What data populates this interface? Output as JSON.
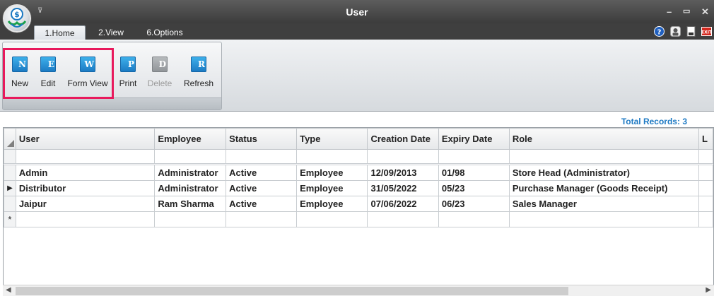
{
  "window": {
    "title": "User",
    "qat_glyph": "⊽",
    "controls": {
      "minimize": "–",
      "maximize": "▭",
      "close": "✕"
    }
  },
  "tabs": [
    {
      "label": "1.Home",
      "active": true
    },
    {
      "label": "2.View",
      "active": false
    },
    {
      "label": "6.Options",
      "active": false
    }
  ],
  "right_icons": [
    "help-icon",
    "user-icon",
    "document-icon",
    "exit-icon"
  ],
  "ribbon": {
    "buttons": [
      {
        "label": "New",
        "letter": "N",
        "enabled": true
      },
      {
        "label": "Edit",
        "letter": "E",
        "enabled": true
      },
      {
        "label": "Form View",
        "letter": "W",
        "enabled": true
      },
      {
        "label": "Print",
        "letter": "P",
        "enabled": true
      },
      {
        "label": "Delete",
        "letter": "D",
        "enabled": false
      },
      {
        "label": "Refresh",
        "letter": "R",
        "enabled": true
      }
    ],
    "highlight_color": "#e8195c"
  },
  "total_records": "Total Records: 3",
  "grid": {
    "columns": [
      "User",
      "Employee",
      "Status",
      "Type",
      "Creation Date",
      "Expiry Date",
      "Role",
      "L"
    ],
    "rows": [
      [
        "Admin",
        "Administrator",
        "Active",
        "Employee",
        "12/09/2013",
        "01/98",
        "Store Head (Administrator)",
        ""
      ],
      [
        "Distributor",
        "Administrator",
        "Active",
        "Employee",
        "31/05/2022",
        "05/23",
        "Purchase Manager (Goods Receipt)",
        ""
      ],
      [
        "Jaipur",
        "Ram Sharma",
        "Active",
        "Employee",
        "07/06/2022",
        "06/23",
        "Sales Manager",
        ""
      ]
    ],
    "current_row_marker": "▶",
    "new_row_marker": "*",
    "current_row_index": 1
  },
  "colors": {
    "titlebar": "#4a4a4a",
    "accent": "#1e7ac4",
    "icon_blue": "#1a78c2"
  }
}
